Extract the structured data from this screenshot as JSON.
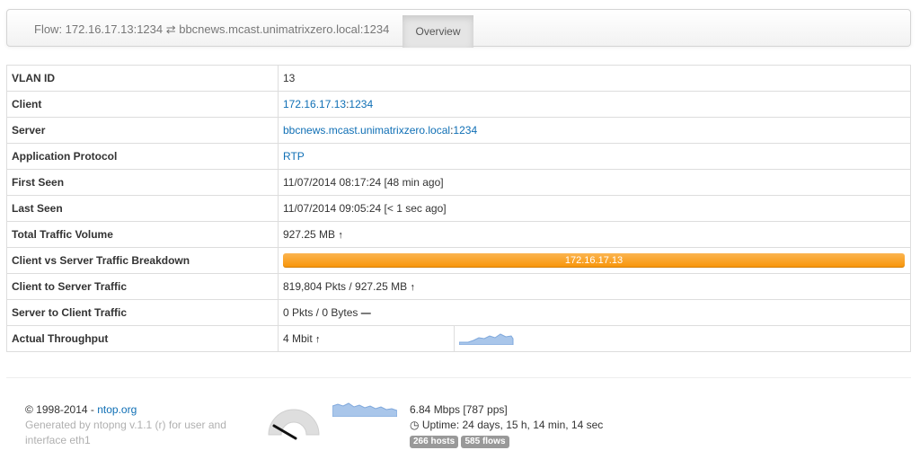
{
  "nav": {
    "brand": "Flow: 172.16.17.13:1234 ⇄ bbcnews.mcast.unimatrixzero.local:1234",
    "tab_overview": "Overview"
  },
  "table": {
    "vlan_label": "VLAN ID",
    "vlan_value": "13",
    "client_label": "Client",
    "client_ip": "172.16.17.13",
    "client_port": "1234",
    "server_label": "Server",
    "server_host": "bbcnews.mcast.unimatrixzero.local",
    "server_port": "1234",
    "proto_label": "Application Protocol",
    "proto_value": "RTP",
    "first_seen_label": "First Seen",
    "first_seen_value": "11/07/2014 08:17:24 [48 min ago]",
    "last_seen_label": "Last Seen",
    "last_seen_value": "11/07/2014 09:05:24 [< 1 sec ago]",
    "total_label": "Total Traffic Volume",
    "total_value": "927.25 MB",
    "breakdown_label": "Client vs Server Traffic Breakdown",
    "breakdown_bar": "172.16.17.13",
    "c2s_label": "Client to Server Traffic",
    "c2s_value": "819,804 Pkts / 927.25 MB",
    "s2c_label": "Server to Client Traffic",
    "s2c_value": "0 Pkts / 0 Bytes",
    "throughput_label": "Actual Throughput",
    "throughput_value": "4 Mbit"
  },
  "footer": {
    "copyright": "© 1998-2014 - ",
    "ntop_link": "ntop.org",
    "generated": "Generated by ntopng v.1.1 (r) for user and interface eth1",
    "rate": "6.84 Mbps [787 pps]",
    "uptime": "Uptime: 24 days, 15 h, 14 min, 14 sec",
    "hosts_badge": "266 hosts",
    "flows_badge": "585 flows"
  },
  "colors": {
    "link": "#0f6fb5",
    "bar": "#f89406",
    "spark": "#a9c6ea",
    "badge": "#999999"
  },
  "icons": {
    "up": "arrow-up-icon",
    "flat": "minus-icon",
    "clock": "clock-icon",
    "gauge": "gauge-icon"
  }
}
